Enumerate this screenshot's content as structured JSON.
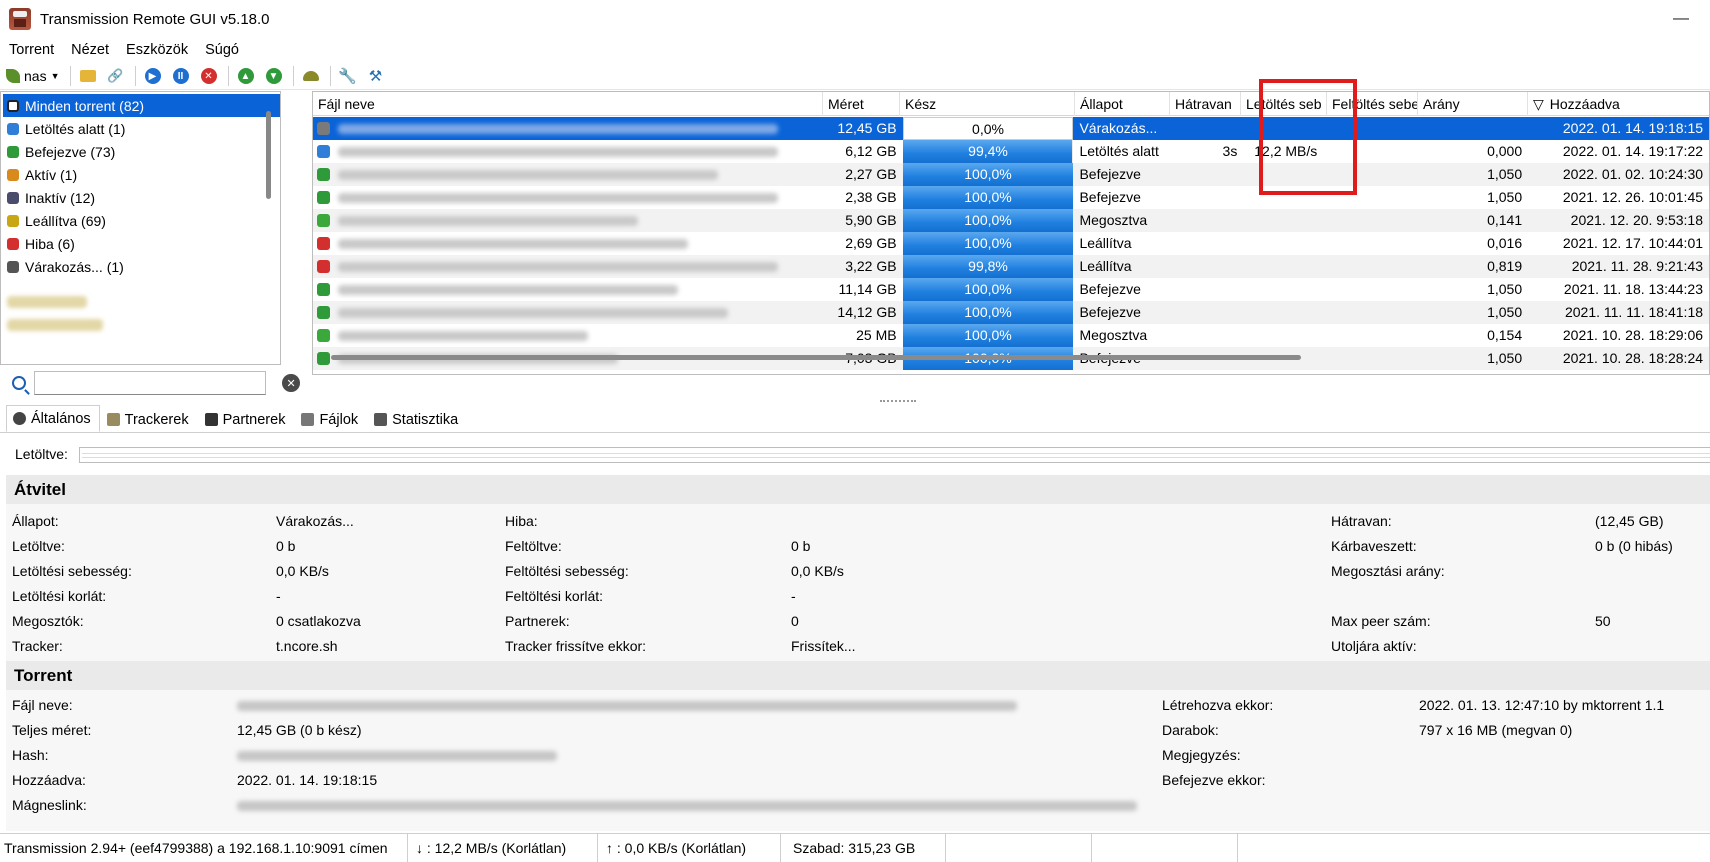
{
  "window": {
    "title": "Transmission Remote GUI v5.18.0",
    "minimize_glyph": "—"
  },
  "menu": [
    "Torrent",
    "Nézet",
    "Eszközök",
    "Súgó"
  ],
  "toolbar": {
    "connection_label": "nas",
    "icons": [
      "open-folder-icon",
      "add-link-icon",
      "start-icon",
      "pause-icon",
      "remove-icon",
      "move-up-icon",
      "move-down-icon",
      "turtle-mode-icon",
      "options-icon",
      "tools-icon"
    ]
  },
  "filters": [
    {
      "label": "Minden torrent (82)",
      "icon": "all-icon",
      "color": "#1a1a1a",
      "selected": true
    },
    {
      "label": "Letöltés alatt (1)",
      "icon": "download-icon",
      "color": "#2f7ed8"
    },
    {
      "label": "Befejezve (73)",
      "icon": "complete-icon",
      "color": "#2f9a3a"
    },
    {
      "label": "Aktív (1)",
      "icon": "active-icon",
      "color": "#d98a1c"
    },
    {
      "label": "Inaktív (12)",
      "icon": "inactive-icon",
      "color": "#4b4b6b"
    },
    {
      "label": "Leállítva (69)",
      "icon": "stopped-icon",
      "color": "#c9a613"
    },
    {
      "label": "Hiba (6)",
      "icon": "error-icon",
      "color": "#d32f2f"
    },
    {
      "label": "Várakozás... (1)",
      "icon": "waiting-icon",
      "color": "#555555"
    }
  ],
  "search": {
    "value": "",
    "placeholder": ""
  },
  "columns": {
    "name": "Fájl neve",
    "size": "Méret",
    "done": "Kész",
    "status": "Állapot",
    "remaining": "Hátravan",
    "down_speed": "Letöltés seb",
    "up_speed": "Feltöltés sebe",
    "ratio": "Arány",
    "added": "Hozzáadva",
    "sort_indicator": "▽"
  },
  "torrents": [
    {
      "size": "12,45 GB",
      "done": "0,0%",
      "progress": 0.0,
      "status": "Várakozás...",
      "remaining": "",
      "down_speed": "",
      "ratio": "",
      "added": "2022. 01. 14. 19:18:15",
      "icon_color": "#7a7a7a"
    },
    {
      "size": "6,12 GB",
      "done": "99,4%",
      "progress": 0.994,
      "status": "Letöltés alatt",
      "remaining": "3s",
      "down_speed": "12,2 MB/s",
      "ratio": "0,000",
      "added": "2022. 01. 14. 19:17:22",
      "icon_color": "#2f7ed8"
    },
    {
      "size": "2,27 GB",
      "done": "100,0%",
      "progress": 1.0,
      "status": "Befejezve",
      "remaining": "",
      "down_speed": "",
      "ratio": "1,050",
      "added": "2022. 01. 02. 10:24:30",
      "icon_color": "#2f9a3a"
    },
    {
      "size": "2,38 GB",
      "done": "100,0%",
      "progress": 1.0,
      "status": "Befejezve",
      "remaining": "",
      "down_speed": "",
      "ratio": "1,050",
      "added": "2021. 12. 26. 10:01:45",
      "icon_color": "#2f9a3a"
    },
    {
      "size": "5,90 GB",
      "done": "100,0%",
      "progress": 1.0,
      "status": "Megosztva",
      "remaining": "",
      "down_speed": "",
      "ratio": "0,141",
      "added": "2021. 12. 20. 9:53:18",
      "icon_color": "#3aa83a"
    },
    {
      "size": "2,69 GB",
      "done": "100,0%",
      "progress": 1.0,
      "status": "Leállítva",
      "remaining": "",
      "down_speed": "",
      "ratio": "0,016",
      "added": "2021. 12. 17. 10:44:01",
      "icon_color": "#d32f2f"
    },
    {
      "size": "3,22 GB",
      "done": "99,8%",
      "progress": 0.998,
      "status": "Leállítva",
      "remaining": "",
      "down_speed": "",
      "ratio": "0,819",
      "added": "2021. 11. 28. 9:21:43",
      "icon_color": "#d32f2f"
    },
    {
      "size": "11,14 GB",
      "done": "100,0%",
      "progress": 1.0,
      "status": "Befejezve",
      "remaining": "",
      "down_speed": "",
      "ratio": "1,050",
      "added": "2021. 11. 18. 13:44:23",
      "icon_color": "#2f9a3a"
    },
    {
      "size": "14,12 GB",
      "done": "100,0%",
      "progress": 1.0,
      "status": "Befejezve",
      "remaining": "",
      "down_speed": "",
      "ratio": "1,050",
      "added": "2021. 11. 11. 18:41:18",
      "icon_color": "#2f9a3a"
    },
    {
      "size": "25 MB",
      "done": "100,0%",
      "progress": 1.0,
      "status": "Megosztva",
      "remaining": "",
      "down_speed": "",
      "ratio": "0,154",
      "added": "2021. 10. 28. 18:29:06",
      "icon_color": "#3aa83a"
    },
    {
      "size": "7,03 GB",
      "done": "100,0%",
      "progress": 1.0,
      "status": "Befejezve",
      "remaining": "",
      "down_speed": "",
      "ratio": "1,050",
      "added": "2021. 10. 28. 18:28:24",
      "icon_color": "#2f9a3a"
    }
  ],
  "tabs": [
    {
      "label": "Általános",
      "icon": "info-icon",
      "active": true
    },
    {
      "label": "Trackerek",
      "icon": "tracker-icon"
    },
    {
      "label": "Partnerek",
      "icon": "peer-icon"
    },
    {
      "label": "Fájlok",
      "icon": "files-icon"
    },
    {
      "label": "Statisztika",
      "icon": "stats-icon"
    }
  ],
  "downloaded_label": "Letöltve:",
  "transfer": {
    "heading": "Átvitel",
    "col1": [
      [
        "Állapot:",
        "Várakozás..."
      ],
      [
        "Letöltve:",
        "0 b"
      ],
      [
        "Letöltési sebesség:",
        "0,0 KB/s"
      ],
      [
        "Letöltési korlát:",
        "-"
      ],
      [
        "Megosztók:",
        "0 csatlakozva"
      ],
      [
        "Tracker:",
        "t.ncore.sh"
      ]
    ],
    "col2": [
      [
        "Hiba:",
        ""
      ],
      [
        "Feltöltve:",
        "0 b"
      ],
      [
        "Feltöltési sebesség:",
        "0,0 KB/s"
      ],
      [
        "Feltöltési korlát:",
        "-"
      ],
      [
        "Partnerek:",
        "0"
      ],
      [
        "Tracker frissítve ekkor:",
        "Frissítek..."
      ]
    ],
    "col3": [
      [
        "Hátravan:",
        "(12,45 GB)"
      ],
      [
        "Kárbaveszett:",
        "0 b (0 hibás)"
      ],
      [
        "Megosztási arány:",
        ""
      ],
      [
        "",
        ""
      ],
      [
        "Max peer szám:",
        "50"
      ],
      [
        "Utoljára aktív:",
        ""
      ]
    ]
  },
  "torrent_info": {
    "heading": "Torrent",
    "col1": [
      [
        "Fájl neve:",
        ""
      ],
      [
        "Teljes méret:",
        "12,45 GB (0 b kész)"
      ],
      [
        "Hash:",
        ""
      ],
      [
        "Hozzáadva:",
        "2022. 01. 14. 19:18:15"
      ],
      [
        "Mágneslink:",
        ""
      ]
    ],
    "col2": [
      [
        "Létrehozva ekkor:",
        "2022. 01. 13. 12:47:10 by mktorrent 1.1"
      ],
      [
        "Darabok:",
        "797 x 16 MB (megvan 0)"
      ],
      [
        "Megjegyzés:",
        ""
      ],
      [
        "Befejezve ekkor:",
        ""
      ]
    ]
  },
  "statusbar": {
    "connection": "Transmission 2.94+ (eef4799388) a 192.168.1.10:9091 címen",
    "download": "↓ : 12,2 MB/s (Korlátlan)",
    "upload": "↑ : 0,0 KB/s (Korlátlan)",
    "free": "Szabad: 315,23 GB"
  }
}
